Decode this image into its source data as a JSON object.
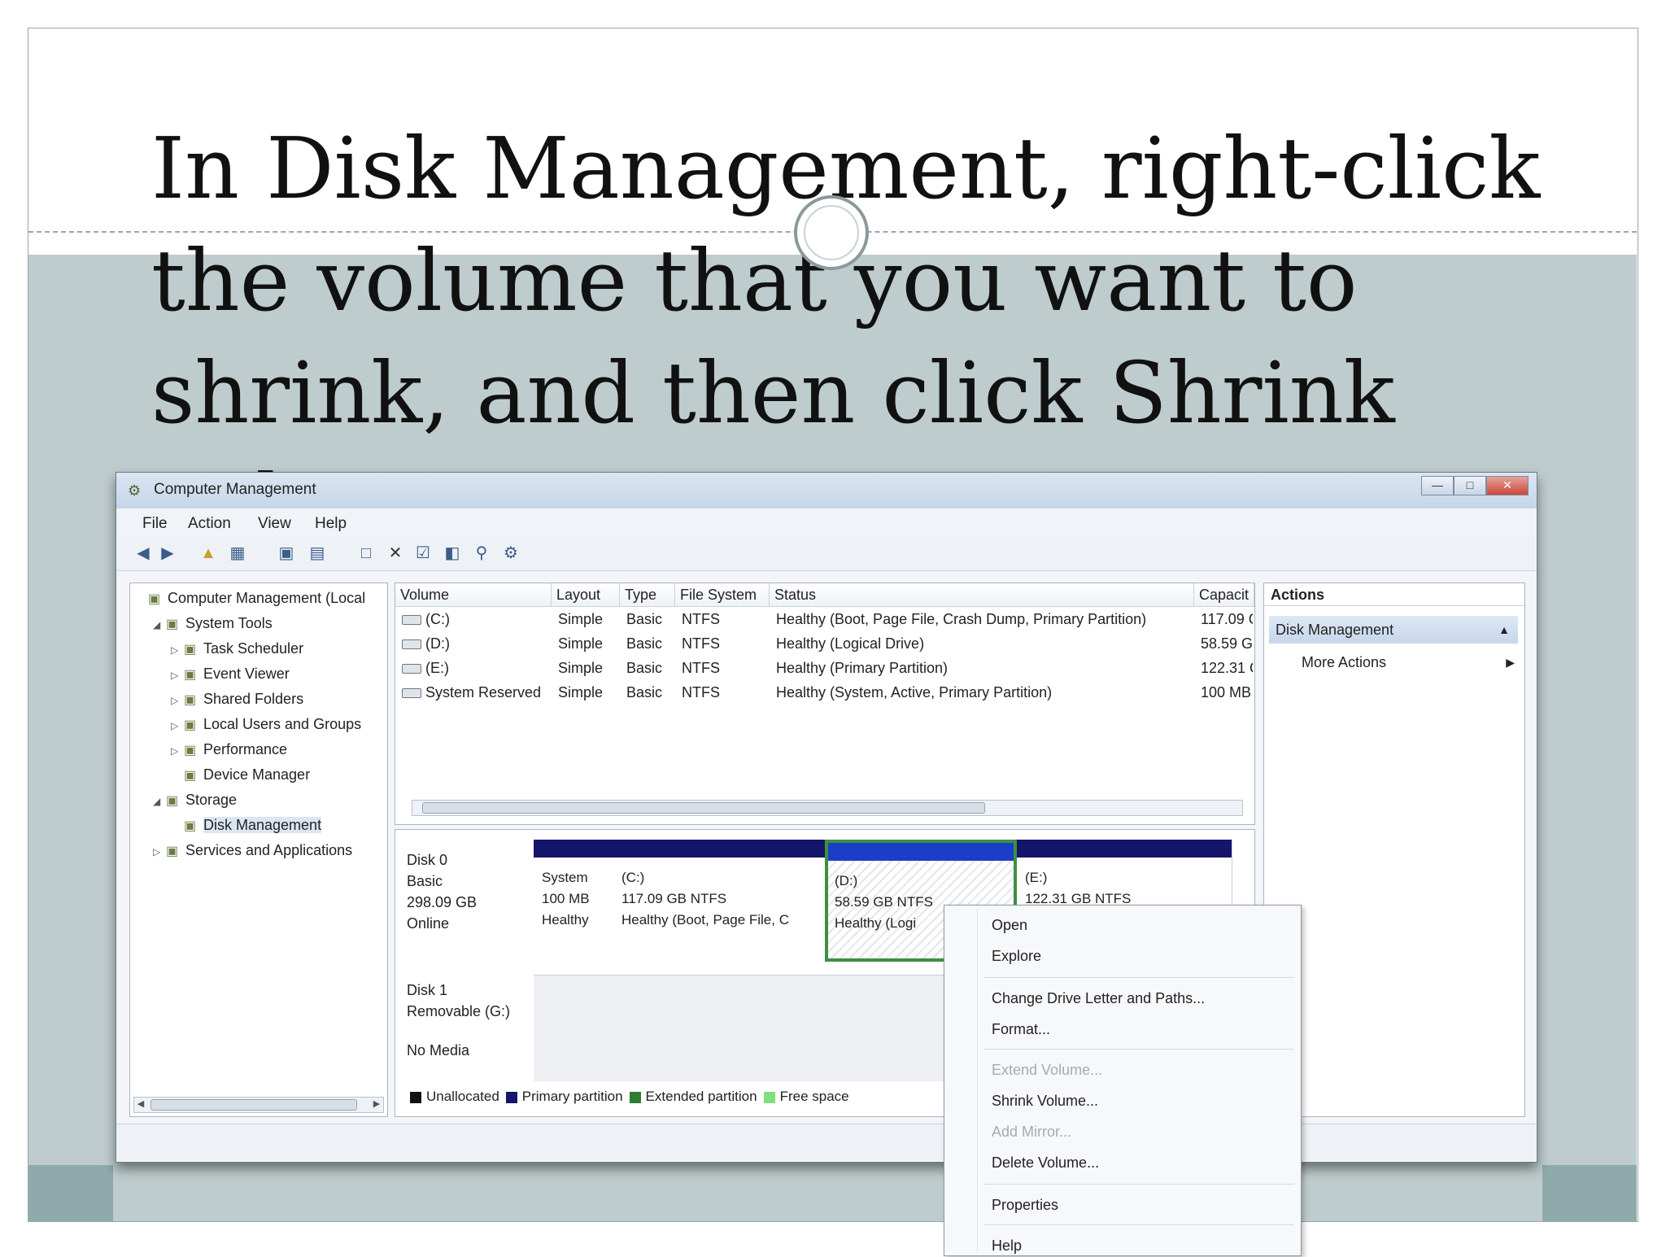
{
  "slide": {
    "title": "In Disk Management, right-click the volume that you want to shrink, and then click Shrink Volume."
  },
  "window": {
    "title": "Computer Management",
    "menu": [
      "File",
      "Action",
      "View",
      "Help"
    ]
  },
  "tree": {
    "items": [
      {
        "label": "Computer Management (Local",
        "level": 0,
        "expander": "",
        "icon": "computer-icon"
      },
      {
        "label": "System Tools",
        "level": 1,
        "expander": "◢",
        "icon": "tools-icon"
      },
      {
        "label": "Task Scheduler",
        "level": 2,
        "expander": "▷",
        "icon": "clock-icon"
      },
      {
        "label": "Event Viewer",
        "level": 2,
        "expander": "▷",
        "icon": "event-icon"
      },
      {
        "label": "Shared Folders",
        "level": 2,
        "expander": "▷",
        "icon": "folder-icon"
      },
      {
        "label": "Local Users and Groups",
        "level": 2,
        "expander": "▷",
        "icon": "users-icon"
      },
      {
        "label": "Performance",
        "level": 2,
        "expander": "▷",
        "icon": "performance-icon"
      },
      {
        "label": "Device Manager",
        "level": 2,
        "expander": "",
        "icon": "device-icon"
      },
      {
        "label": "Storage",
        "level": 1,
        "expander": "◢",
        "icon": "storage-icon"
      },
      {
        "label": "Disk Management",
        "level": 2,
        "expander": "",
        "icon": "disk-icon",
        "selected": true
      },
      {
        "label": "Services and Applications",
        "level": 1,
        "expander": "▷",
        "icon": "services-icon"
      }
    ]
  },
  "volumes": {
    "columns": [
      "Volume",
      "Layout",
      "Type",
      "File System",
      "Status",
      "Capacit"
    ],
    "rows": [
      {
        "volume": "(C:)",
        "layout": "Simple",
        "type": "Basic",
        "fs": "NTFS",
        "status": "Healthy (Boot, Page File, Crash Dump, Primary Partition)",
        "capacity": "117.09 G"
      },
      {
        "volume": "(D:)",
        "layout": "Simple",
        "type": "Basic",
        "fs": "NTFS",
        "status": "Healthy (Logical Drive)",
        "capacity": "58.59 G"
      },
      {
        "volume": "(E:)",
        "layout": "Simple",
        "type": "Basic",
        "fs": "NTFS",
        "status": "Healthy (Primary Partition)",
        "capacity": "122.31 G"
      },
      {
        "volume": "System Reserved",
        "layout": "Simple",
        "type": "Basic",
        "fs": "NTFS",
        "status": "Healthy (System, Active, Primary Partition)",
        "capacity": "100 MB"
      }
    ]
  },
  "disks": {
    "disk0": {
      "name": "Disk 0",
      "type": "Basic",
      "size": "298.09 GB",
      "state": "Online"
    },
    "partitions": [
      {
        "name": "System",
        "size": "100 MB",
        "status": "Healthy"
      },
      {
        "name": "(C:)",
        "size": "117.09 GB NTFS",
        "status": "Healthy (Boot, Page File, C"
      },
      {
        "name": "(D:)",
        "size": "58.59 GB NTFS",
        "status": "Healthy (Logi"
      },
      {
        "name": "(E:)",
        "size": "122.31 GB NTFS",
        "status": ""
      }
    ],
    "disk1": {
      "name": "Disk 1",
      "type": "Removable (G:)",
      "state": "No Media"
    }
  },
  "legend": [
    {
      "label": "Unallocated",
      "color": "#111111"
    },
    {
      "label": "Primary partition",
      "color": "#15156b"
    },
    {
      "label": "Extended partition",
      "color": "#2e7d32"
    },
    {
      "label": "Free space",
      "color": "#7ee07e"
    }
  ],
  "actions": {
    "header": "Actions",
    "section": "Disk Management",
    "more": "More Actions"
  },
  "context_menu": {
    "items": [
      {
        "label": "Open",
        "disabled": false
      },
      {
        "label": "Explore",
        "disabled": false
      },
      {
        "label": "Change Drive Letter and Paths...",
        "disabled": false
      },
      {
        "label": "Format...",
        "disabled": false
      },
      {
        "label": "Extend Volume...",
        "disabled": true
      },
      {
        "label": "Shrink Volume...",
        "disabled": false
      },
      {
        "label": "Add Mirror...",
        "disabled": true
      },
      {
        "label": "Delete Volume...",
        "disabled": false
      },
      {
        "label": "Properties",
        "disabled": false
      },
      {
        "label": "Help",
        "disabled": false
      }
    ]
  }
}
